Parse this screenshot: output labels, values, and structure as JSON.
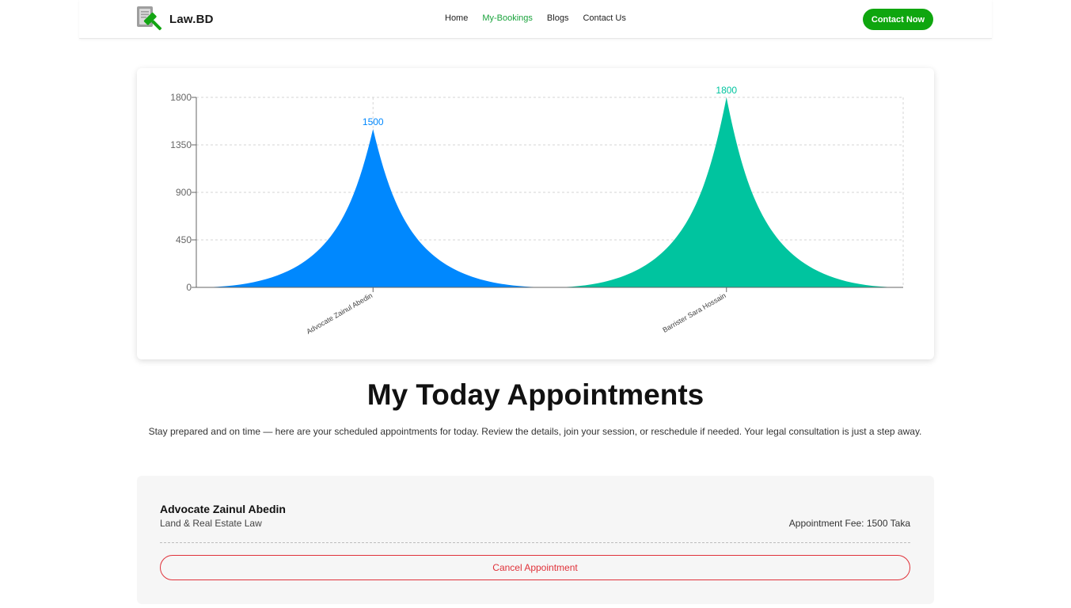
{
  "brand": {
    "name": "Law.BD"
  },
  "nav": {
    "items": [
      {
        "label": "Home",
        "active": false
      },
      {
        "label": "My-Bookings",
        "active": true
      },
      {
        "label": "Blogs",
        "active": false
      },
      {
        "label": "Contact Us",
        "active": false
      }
    ],
    "cta_label": "Contact Now"
  },
  "colors": {
    "brand_green": "#0fa60f",
    "active_link": "#1aa33c",
    "series_blue": "#0088fe",
    "series_teal": "#00c49f",
    "cancel_red": "#e0323a"
  },
  "chart_data": {
    "type": "area",
    "categories": [
      "Advocate Zainul Abedin",
      "Barrister Sara Hossain"
    ],
    "values": [
      1500,
      1800
    ],
    "colors": [
      "#0088fe",
      "#00c49f"
    ],
    "data_labels": [
      "1500",
      "1800"
    ],
    "yticks": [
      "0",
      "450",
      "900",
      "1350",
      "1800"
    ],
    "ylim": [
      0,
      1800
    ],
    "grid": true,
    "shape": "triangle-spike"
  },
  "appointments": {
    "title": "My Today Appointments",
    "description": "Stay prepared and on time — here are your scheduled appointments for today. Review the details, join your session, or reschedule if needed. Your legal consultation is just a step away.",
    "items": [
      {
        "lawyer_name": "Advocate Zainul Abedin",
        "specialty": "Land & Real Estate Law",
        "fee_text": "Appointment Fee: 1500 Taka",
        "cancel_label": "Cancel Appointment"
      }
    ]
  }
}
